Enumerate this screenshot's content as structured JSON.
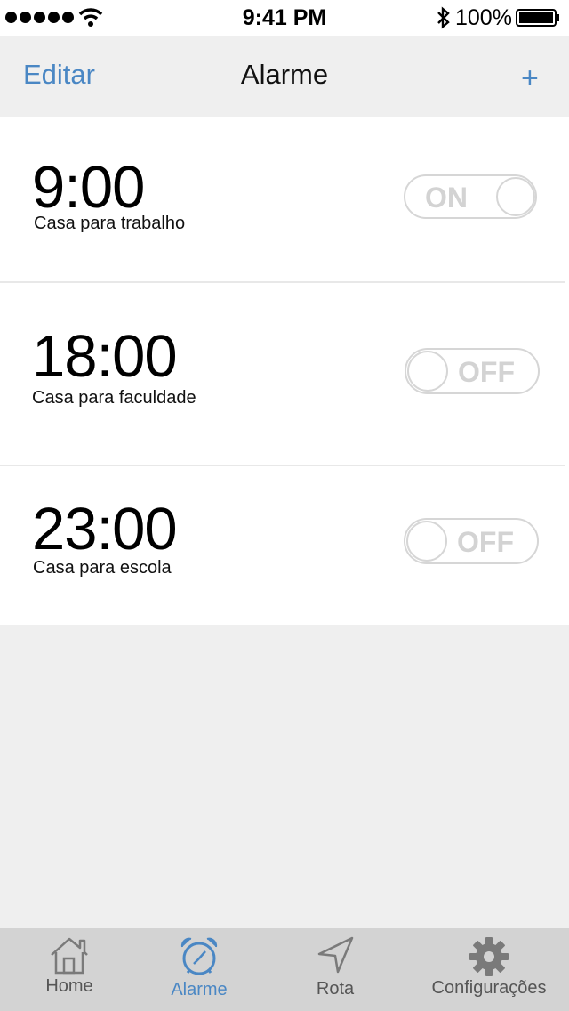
{
  "status_bar": {
    "time": "9:41 PM",
    "battery": "100%",
    "icons": [
      "signal-dots-icon",
      "wifi-icon",
      "bluetooth-icon",
      "battery-icon"
    ]
  },
  "nav": {
    "edit_label": "Editar",
    "title": "Alarme",
    "add_label": "+"
  },
  "alarms": [
    {
      "time": "9:00",
      "label": "Casa para trabalho",
      "toggle_text": "ON",
      "enabled": true
    },
    {
      "time": "18:00",
      "label": "Casa para faculdade",
      "toggle_text": "OFF",
      "enabled": false
    },
    {
      "time": "23:00",
      "label": "Casa para escola",
      "toggle_text": "OFF",
      "enabled": false
    }
  ],
  "tabs": [
    {
      "label": "Home",
      "icon": "home-icon",
      "active": false
    },
    {
      "label": "Alarme",
      "icon": "alarm-clock-icon",
      "active": true
    },
    {
      "label": "Rota",
      "icon": "navigation-arrow-icon",
      "active": false
    },
    {
      "label": "Configurações",
      "icon": "gear-icon",
      "active": false
    }
  ],
  "colors": {
    "accent": "#4a87c4",
    "background": "#efefef",
    "tab_bar": "#d3d3d3",
    "toggle_border": "#d6d6d6"
  }
}
